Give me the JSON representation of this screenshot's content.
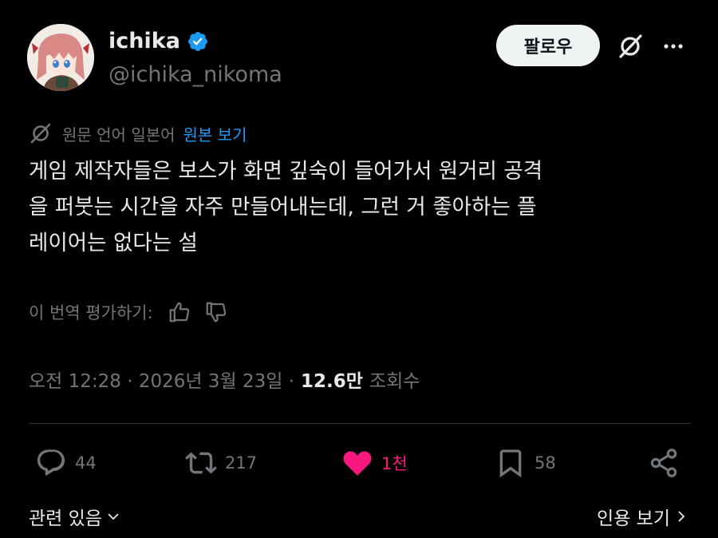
{
  "author": {
    "display_name": "ichika",
    "handle": "@ichika_nikoma",
    "verified_icon": "verified-badge-icon",
    "verified_color": "#1d9bf0"
  },
  "header": {
    "follow_label": "팔로우",
    "grok_icon": "grok-icon",
    "more_icon": "more-icon"
  },
  "translation": {
    "note": "원문 언어 일본어",
    "link": "원본 보기",
    "link_color": "#1d9bf0"
  },
  "tweet": {
    "lines": [
      "게임 제작자들은 보스가 화면 깊숙이 들어가서 원거리 공격",
      "을 퍼붓는 시간을 자주 만들어내는데, 그런 거 좋아하는 플",
      "레이어는 없다는 설"
    ]
  },
  "rating": {
    "label": "이 번역 평가하기:"
  },
  "meta": {
    "timestamp": "오전 12:28 · 2026년 3월 23일 ·",
    "views": "12.6만",
    "views_label": "조회수"
  },
  "actions": {
    "replies": "44",
    "reposts": "217",
    "likes": "1천",
    "bookmarks": "58",
    "like_color": "#f91880"
  },
  "footer": {
    "related": "관련 있음",
    "quotes": "인용 보기"
  }
}
